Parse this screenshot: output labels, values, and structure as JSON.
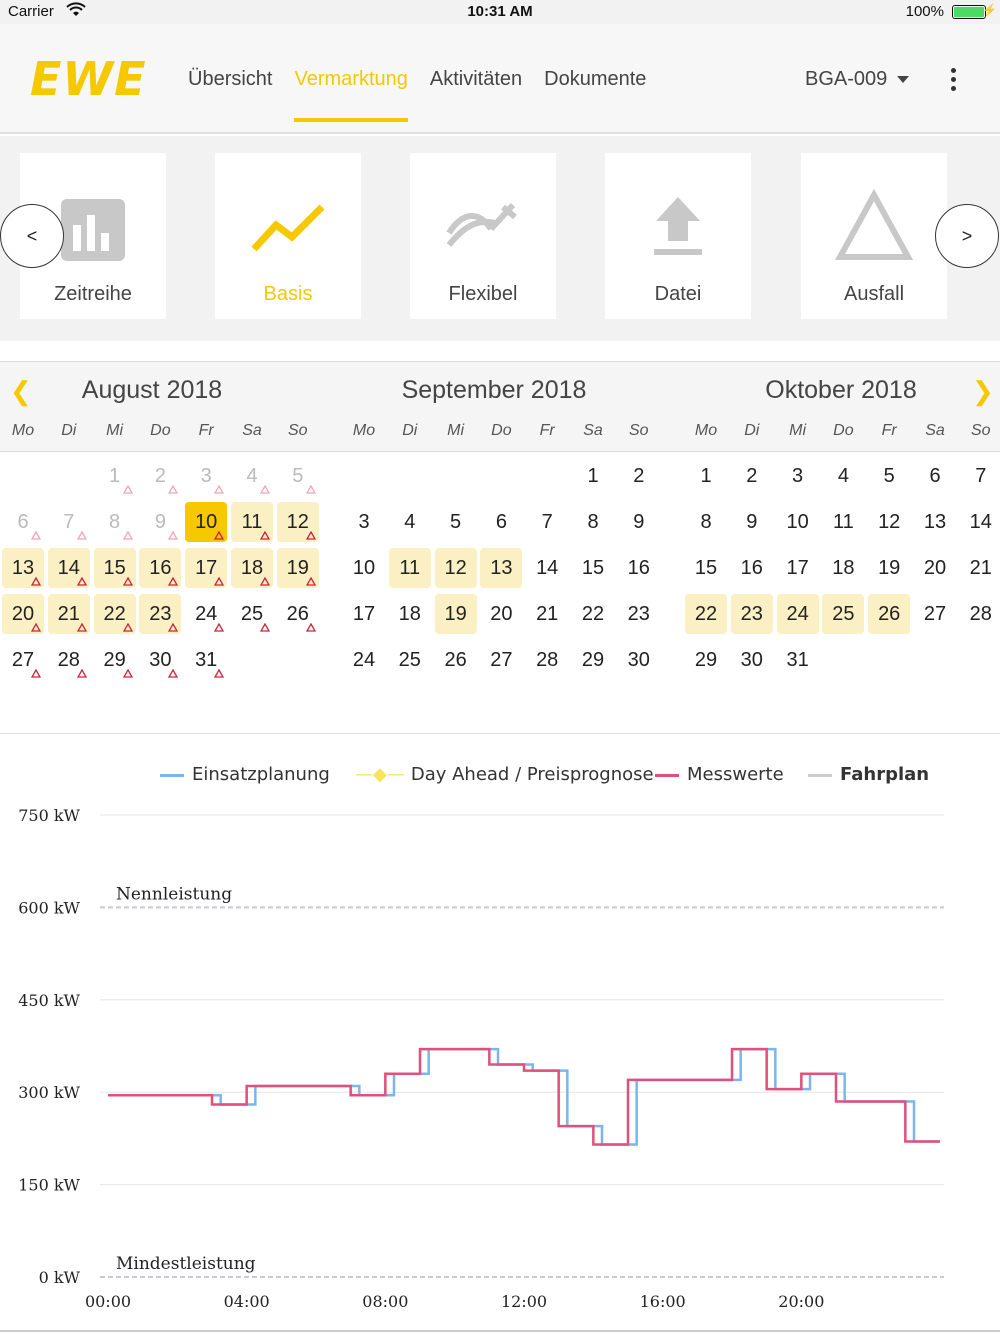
{
  "status_bar": {
    "carrier": "Carrier",
    "time": "10:31 AM",
    "battery": "100%"
  },
  "header": {
    "logo": "EWE",
    "tabs": [
      {
        "label": "Übersicht",
        "active": false
      },
      {
        "label": "Vermarktung",
        "active": true
      },
      {
        "label": "Aktivitäten",
        "active": false
      },
      {
        "label": "Dokumente",
        "active": false
      }
    ],
    "plant": "BGA-009"
  },
  "modes": {
    "prev": "<",
    "next": ">",
    "items": [
      {
        "label": "Zeitreihe",
        "icon": "bar-chart-icon",
        "active": false
      },
      {
        "label": "Basis",
        "icon": "trend-line-icon",
        "active": true
      },
      {
        "label": "Flexibel",
        "icon": "flex-curve-icon",
        "active": false
      },
      {
        "label": "Datei",
        "icon": "upload-icon",
        "active": false
      },
      {
        "label": "Ausfall",
        "icon": "warning-triangle-icon",
        "active": false
      }
    ]
  },
  "calendar": {
    "weekdays": [
      "Mo",
      "Di",
      "Mi",
      "Do",
      "Fr",
      "Sa",
      "So"
    ],
    "months": [
      {
        "title": "August 2018",
        "first_weekday": 2,
        "days": 31,
        "pre_days": [
          1,
          2,
          3,
          4,
          5,
          6,
          7,
          8,
          9
        ],
        "highlighted": [
          11,
          12,
          13,
          14,
          15,
          16,
          17,
          18,
          19,
          20,
          21,
          22,
          23
        ],
        "selected": 10,
        "marked": [
          1,
          2,
          3,
          4,
          5,
          6,
          7,
          8,
          9,
          10,
          11,
          12,
          13,
          14,
          15,
          16,
          17,
          18,
          19,
          20,
          21,
          22,
          23,
          24,
          25,
          26,
          27,
          28,
          29,
          30,
          31
        ]
      },
      {
        "title": "September 2018",
        "first_weekday": 5,
        "days": 30,
        "pre_days": [],
        "highlighted": [
          11,
          12,
          13,
          19
        ],
        "selected": null,
        "marked": []
      },
      {
        "title": "Oktober 2018",
        "first_weekday": 0,
        "days": 31,
        "pre_days": [],
        "highlighted": [
          22,
          23,
          24,
          25,
          26
        ],
        "selected": null,
        "marked": []
      }
    ]
  },
  "chart_data": {
    "type": "line",
    "title": "",
    "xlabel": "",
    "ylabel": "",
    "x_ticks": [
      "00:00",
      "04:00",
      "08:00",
      "12:00",
      "16:00",
      "20:00"
    ],
    "y_ticks": [
      "0 kW",
      "150 kW",
      "300 kW",
      "450 kW",
      "600 kW",
      "750 kW"
    ],
    "ylim": [
      0,
      750
    ],
    "xlim_hours": [
      0,
      24
    ],
    "grid": true,
    "legend": [
      "Einsatzplanung",
      "Day Ahead / Preisprognose",
      "Messwerte",
      "Fahrplan"
    ],
    "legend_colors": [
      "#7cb5ec",
      "#f7e45a",
      "#e0507a",
      "#cccccc"
    ],
    "reference_lines": [
      {
        "label": "Nennleistung",
        "value": 600
      },
      {
        "label": "Mindestleistung",
        "value": 0
      }
    ],
    "series": [
      {
        "name": "Einsatzplanung",
        "color": "#7cb5ec",
        "step_x": [
          0,
          3.25,
          4.25,
          7.25,
          8.25,
          9.25,
          11.25,
          12.25,
          13.25,
          14.25,
          15.25,
          18.25,
          19.25,
          20.25,
          21.25,
          23.25,
          24
        ],
        "step_y": [
          295,
          280,
          310,
          295,
          330,
          370,
          345,
          335,
          245,
          215,
          320,
          370,
          305,
          330,
          285,
          220,
          220
        ]
      },
      {
        "name": "Messwerte",
        "color": "#e0507a",
        "step_x": [
          0,
          3.0,
          4.0,
          7.0,
          8.0,
          9.0,
          11.0,
          12.0,
          13.0,
          14.0,
          15.0,
          18.0,
          19.0,
          20.0,
          21.0,
          23.0,
          24
        ],
        "step_y": [
          295,
          280,
          310,
          295,
          330,
          370,
          345,
          335,
          245,
          215,
          320,
          370,
          305,
          330,
          285,
          220,
          220
        ]
      }
    ]
  }
}
